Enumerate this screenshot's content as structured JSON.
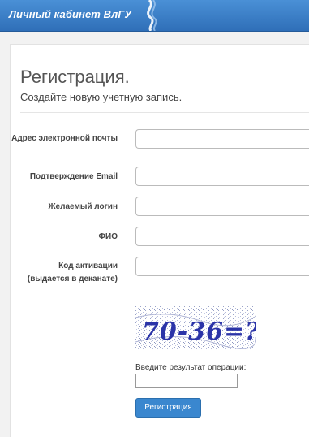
{
  "header": {
    "title": "Личный кабинет ВлГУ"
  },
  "page": {
    "title": "Регистрация.",
    "subtitle": "Создайте новую учетную запись."
  },
  "form": {
    "email_label": "Адрес электронной почты",
    "email_confirm_label": "Подтверждение Email",
    "login_label": "Желаемый логин",
    "fio_label": "ФИО",
    "activation_label_line1": "Код активации",
    "activation_label_line2": "(выдается в деканате)",
    "captcha_text": "70-36=?",
    "captcha_prompt": "Введите результат операции:",
    "submit_label": "Регистрация"
  }
}
